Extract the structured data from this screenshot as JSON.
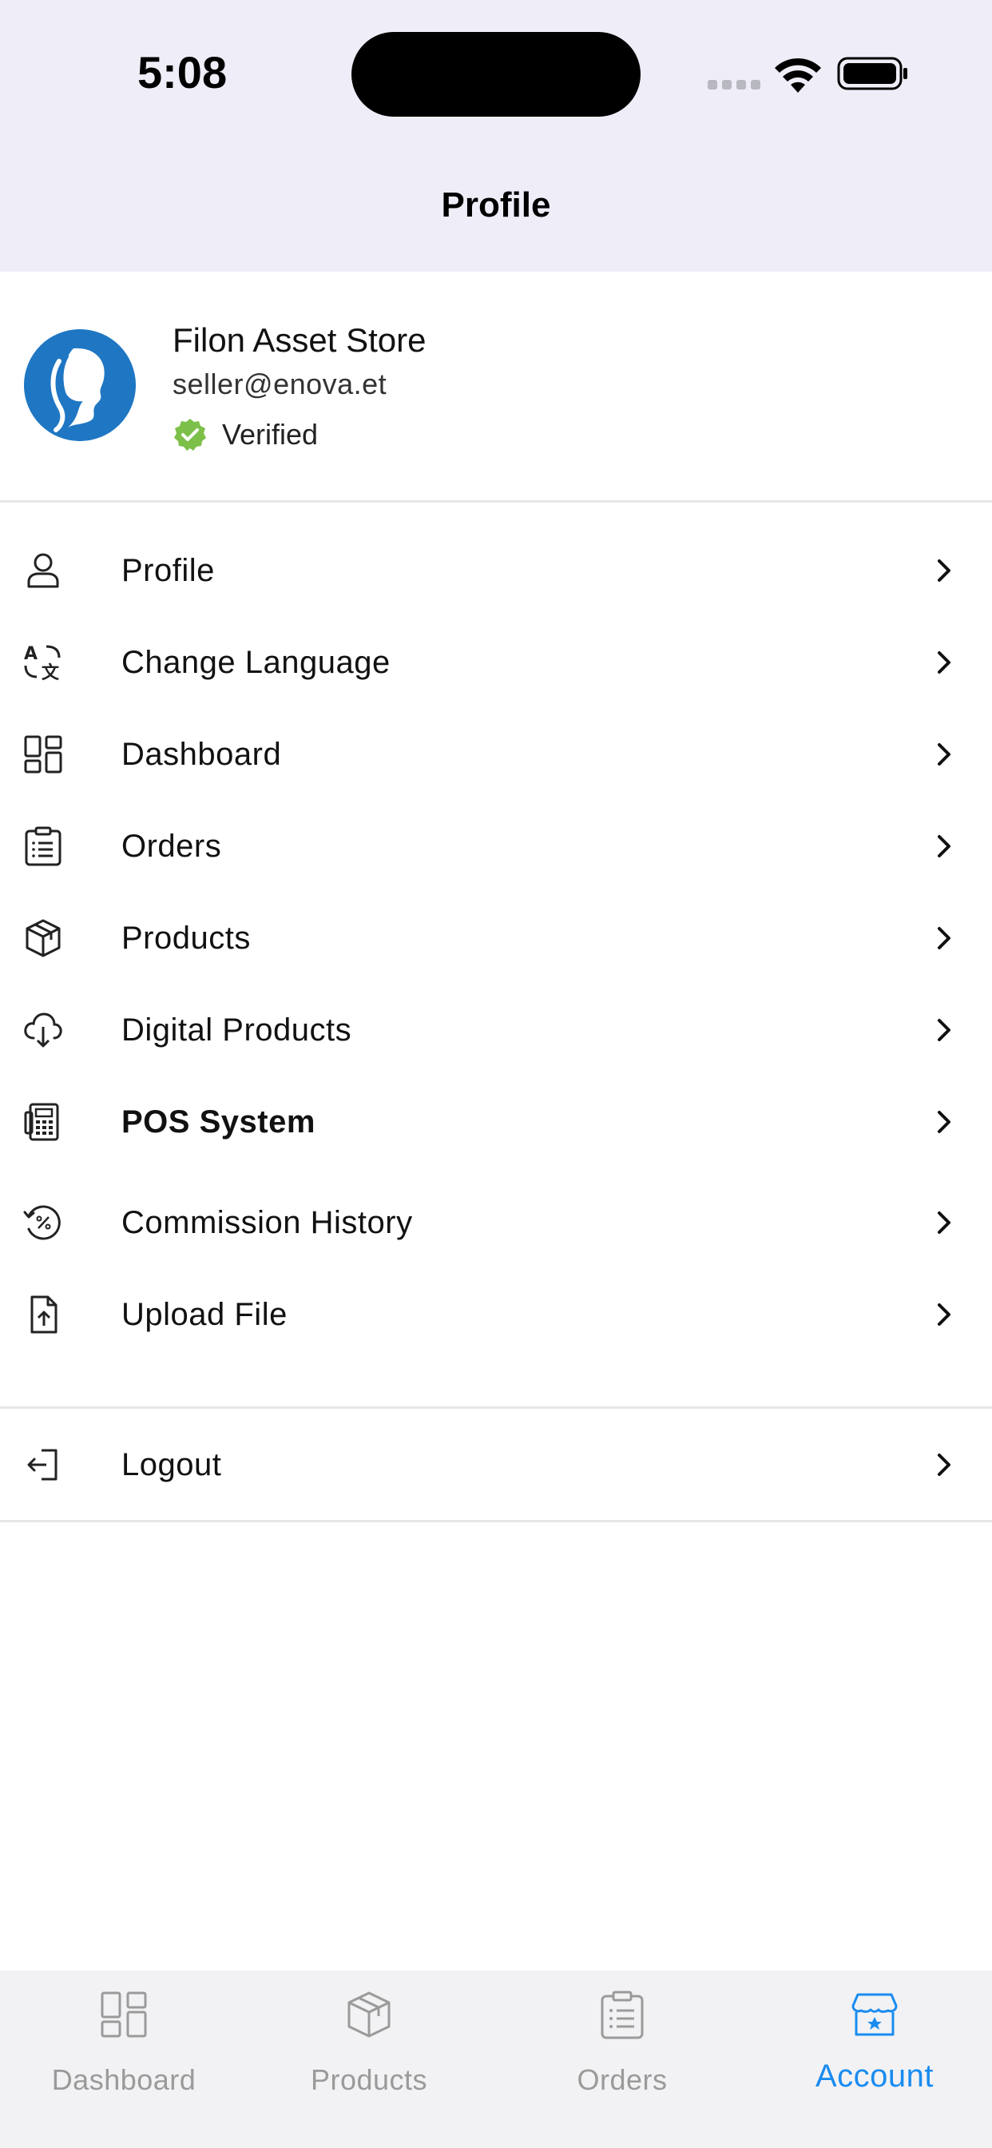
{
  "status_bar": {
    "time": "5:08"
  },
  "header": {
    "title": "Profile"
  },
  "profile": {
    "store_name": "Filon Asset Store",
    "email": "seller@enova.et",
    "verified_label": "Verified"
  },
  "menu": {
    "items": [
      {
        "label": "Profile",
        "icon": "user-icon"
      },
      {
        "label": "Change Language",
        "icon": "translate-icon"
      },
      {
        "label": "Dashboard",
        "icon": "dashboard-icon"
      },
      {
        "label": "Orders",
        "icon": "clipboard-list-icon"
      },
      {
        "label": "Products",
        "icon": "box-icon"
      },
      {
        "label": "Digital Products",
        "icon": "cloud-download-icon"
      },
      {
        "label": "POS System",
        "icon": "calculator-icon"
      },
      {
        "label": "Commission History",
        "icon": "percent-history-icon"
      },
      {
        "label": "Upload File",
        "icon": "file-upload-icon"
      }
    ],
    "logout": {
      "label": "Logout",
      "icon": "logout-icon"
    }
  },
  "tabbar": {
    "tabs": [
      {
        "label": "Dashboard",
        "icon": "dashboard-icon",
        "active": false
      },
      {
        "label": "Products",
        "icon": "box-icon",
        "active": false
      },
      {
        "label": "Orders",
        "icon": "clipboard-list-icon",
        "active": false
      },
      {
        "label": "Account",
        "icon": "store-icon",
        "active": true
      }
    ]
  },
  "colors": {
    "header_bg": "#efedf7",
    "accent": "#1a8cf0",
    "verified_green": "#7cc04a",
    "avatar_blue": "#1f77c4",
    "inactive_tab": "#9a9a9a"
  }
}
